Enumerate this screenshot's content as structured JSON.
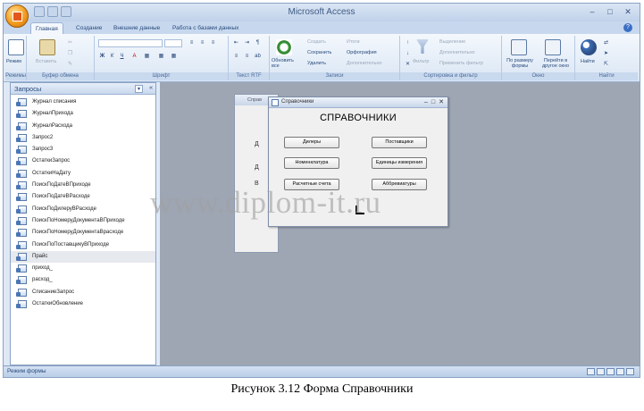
{
  "window": {
    "title": "Microsoft Access"
  },
  "ribbon_tabs": [
    "Главная",
    "Создание",
    "Внешние данные",
    "Работа с базами данных"
  ],
  "ribbon": {
    "views": {
      "label": "Режим",
      "group": "Режимы"
    },
    "clipboard": {
      "paste": "Вставить",
      "group": "Буфер обмена"
    },
    "font": {
      "group": "Шрифт"
    },
    "rtf": {
      "group": "Текст RTF"
    },
    "records": {
      "refresh": "Обновить все",
      "create": "Создать",
      "save": "Сохранить",
      "delete": "Удалить",
      "totals": "Итоги",
      "spelling": "Орфография",
      "more": "Дополнительно",
      "group": "Записи"
    },
    "sort_filter": {
      "filter": "Фильтр",
      "selection": "Выделение",
      "advanced": "Дополнительно",
      "apply": "Применить фильтр",
      "group": "Сортировка и фильтр"
    },
    "window": {
      "fit": "По размеру формы",
      "switch": "Перейти в другое окно",
      "group": "Окно"
    },
    "find": {
      "label": "Найти",
      "group": "Найти"
    }
  },
  "nav_pane": {
    "title": "Запросы",
    "items": [
      "Журнал списания",
      "ЖурналПрихода",
      "ЖурналРасхода",
      "Запрос2",
      "Запрос3",
      "ОстаткиЗапрос",
      "ОстаткиНаДату",
      "ПоискПоДатеВПриходе",
      "ПоискПоДатеВРасходе",
      "ПоискПоДилеруВРасходе",
      "ПоискПоНомеруДокументаВПриходе",
      "ПоискПоНомеруДокументаВрасходе",
      "ПоискПоПоставщикуВПриходе",
      "Прайс",
      "приход_",
      "расход_",
      "СписаниеЗапрос",
      "ОстаткиОбновление"
    ],
    "selected_index": 13
  },
  "form": {
    "title": "Справочники",
    "heading": "СПРАВОЧНИКИ",
    "buttons": {
      "dealers": "Дилеры",
      "nomenclature": "Номенклатура",
      "settlement_accounts": "Расчетные счета",
      "suppliers": "Поставщики",
      "units": "Единицы измерения",
      "abbreviations": "Аббревиатуры"
    }
  },
  "background_form": {
    "title": "Справ",
    "letters": [
      "Д",
      "Д",
      "В"
    ]
  },
  "statusbar": {
    "text": "Режим формы"
  },
  "watermark": "www.diplom-it.ru",
  "caption": "Рисунок 3.12 Форма Справочники"
}
